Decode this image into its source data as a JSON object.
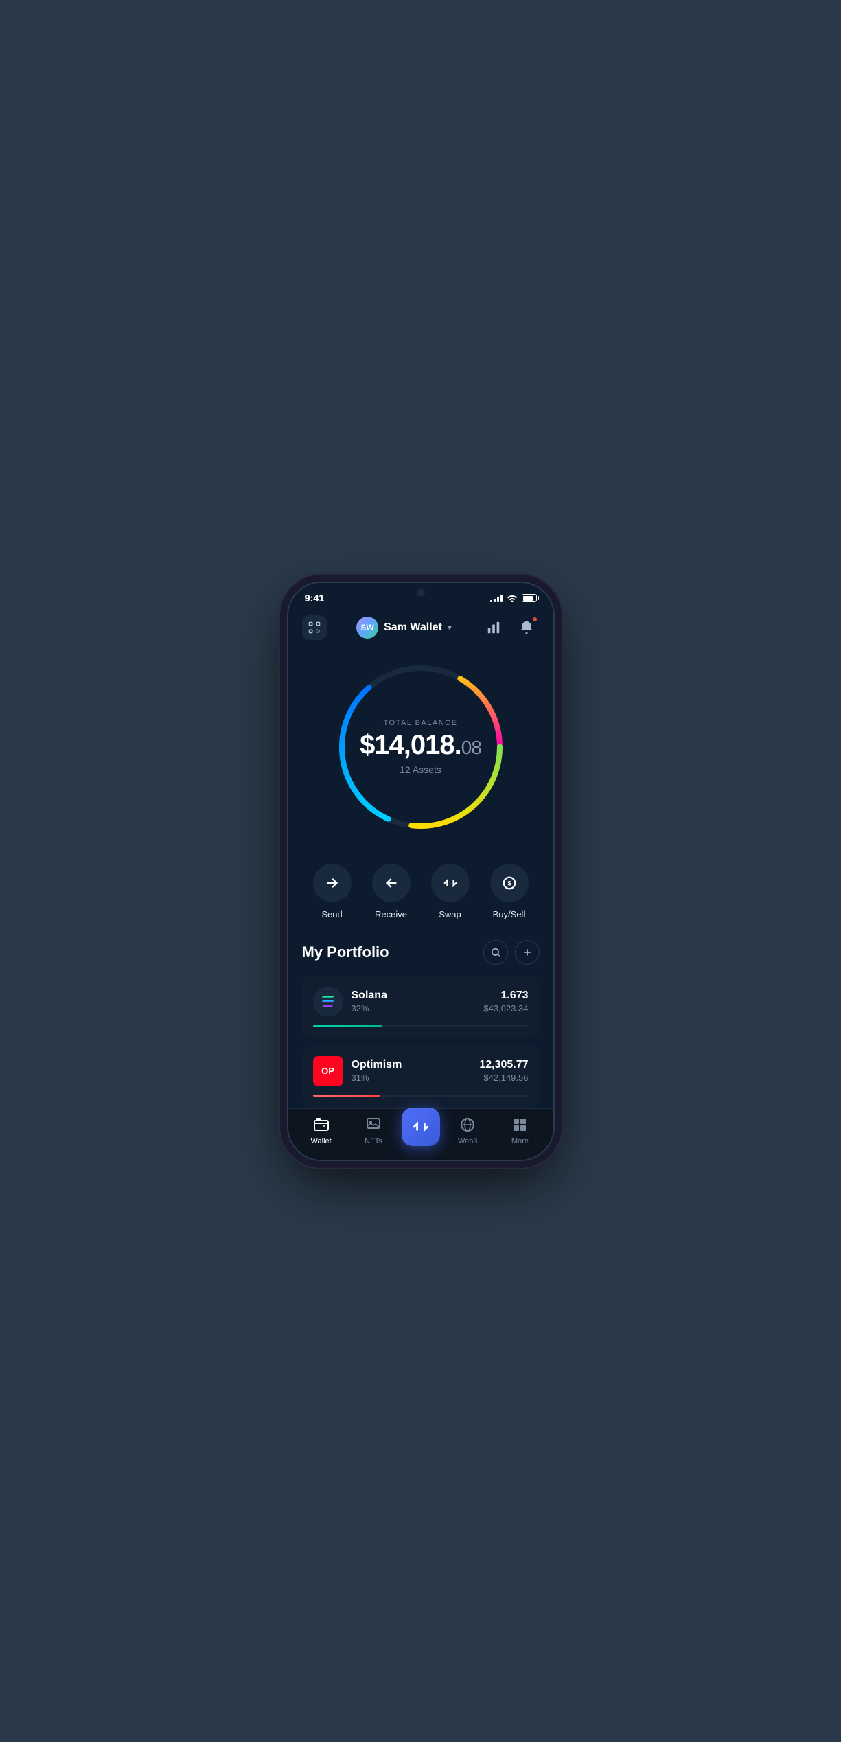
{
  "status": {
    "time": "9:41",
    "signal_bars": [
      3,
      6,
      9,
      11
    ],
    "battery_pct": 85
  },
  "header": {
    "wallet_name": "Sam Wallet",
    "avatar_initials": "SW",
    "scan_icon": "scan-icon",
    "chart_icon": "chart-icon",
    "bell_icon": "bell-icon"
  },
  "balance": {
    "label": "TOTAL BALANCE",
    "main": "$14,018.",
    "cents": "08",
    "assets_label": "12 Assets"
  },
  "actions": [
    {
      "id": "send",
      "label": "Send",
      "icon": "arrow-right"
    },
    {
      "id": "receive",
      "label": "Receive",
      "icon": "arrow-left"
    },
    {
      "id": "swap",
      "label": "Swap",
      "icon": "swap"
    },
    {
      "id": "buy-sell",
      "label": "Buy/Sell",
      "icon": "dollar-circle"
    }
  ],
  "portfolio": {
    "title": "My Portfolio",
    "search_label": "search",
    "add_label": "add",
    "assets": [
      {
        "name": "Solana",
        "pct": "32%",
        "amount": "1.673",
        "usd": "$43,023.34",
        "progress": 32,
        "color": "solana",
        "logo_text": "S"
      },
      {
        "name": "Optimism",
        "pct": "31%",
        "amount": "12,305.77",
        "usd": "$42,149.56",
        "progress": 31,
        "color": "optimism",
        "logo_text": "OP"
      }
    ]
  },
  "nav": {
    "items": [
      {
        "id": "wallet",
        "label": "Wallet",
        "active": true,
        "icon": "wallet-icon"
      },
      {
        "id": "nfts",
        "label": "NFTs",
        "active": false,
        "icon": "nfts-icon"
      },
      {
        "id": "swap-center",
        "label": "",
        "active": false,
        "icon": "swap-center-icon"
      },
      {
        "id": "web3",
        "label": "Web3",
        "active": false,
        "icon": "web3-icon"
      },
      {
        "id": "more",
        "label": "More",
        "active": false,
        "icon": "more-icon"
      }
    ]
  }
}
